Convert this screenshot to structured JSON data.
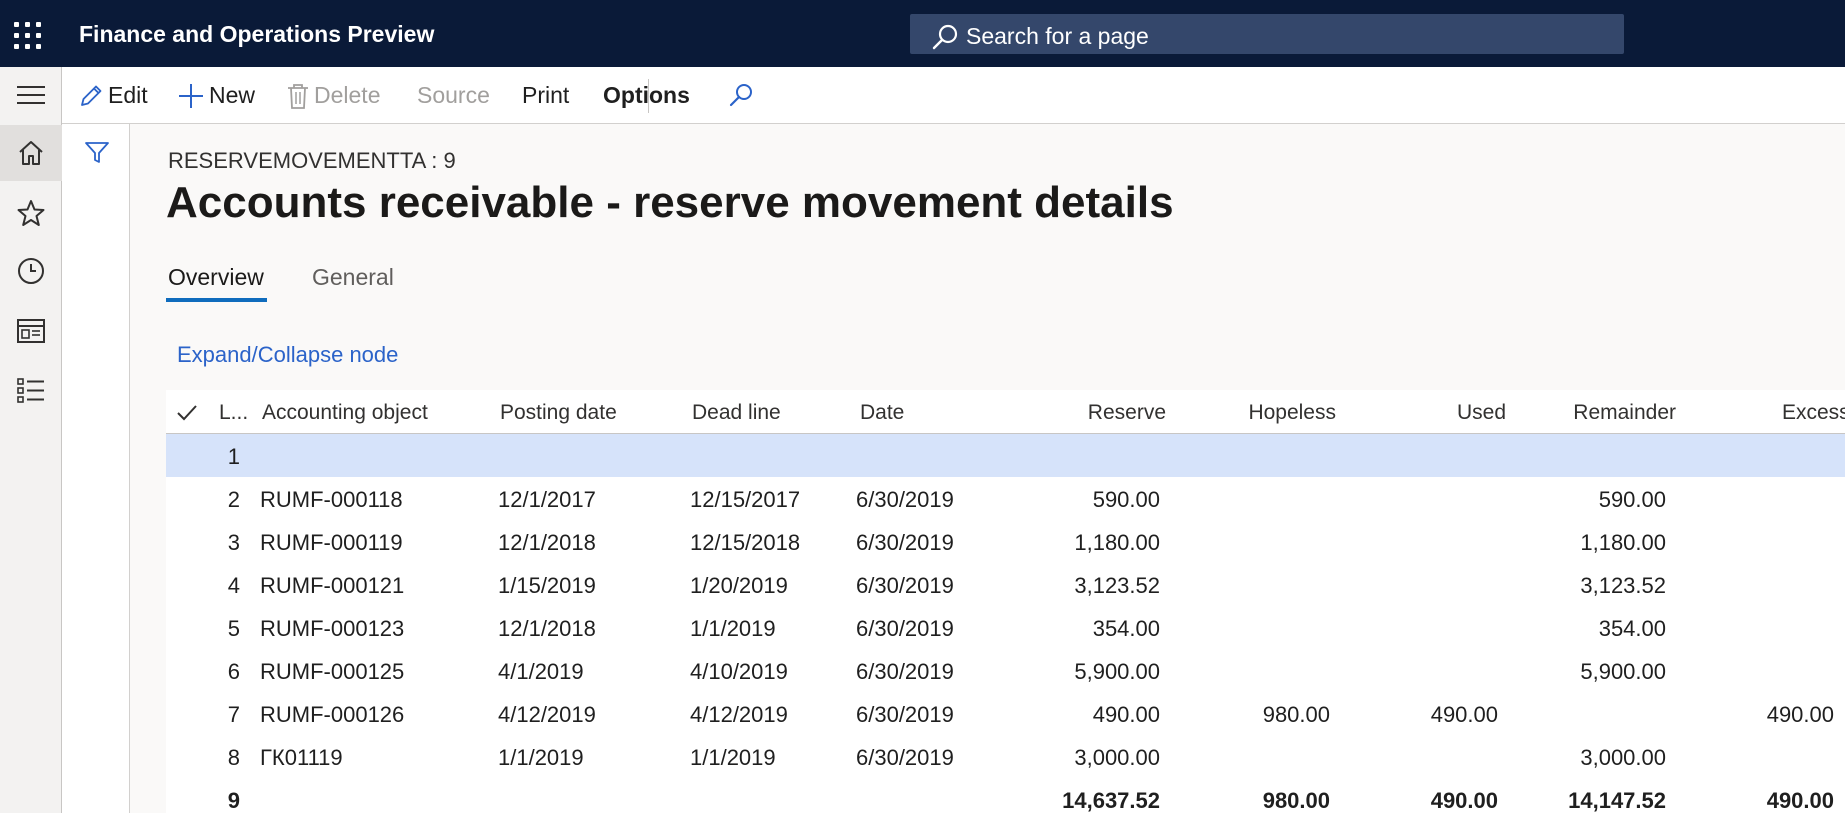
{
  "app": {
    "title": "Finance and Operations Preview",
    "search_placeholder": "Search for a page"
  },
  "nav_rail": {
    "items": [
      "menu-icon",
      "home-icon",
      "star-icon",
      "clock-icon",
      "workspace-icon",
      "list-icon"
    ]
  },
  "action_pane": {
    "edit_label": "Edit",
    "new_label": "New",
    "delete_label": "Delete",
    "source_label": "Source",
    "print_label": "Print",
    "options_label": "Options"
  },
  "page": {
    "caption": "RESERVEMOVEMENTTA : 9",
    "title": "Accounts receivable - reserve movement details",
    "tabs": [
      {
        "label": "Overview",
        "active": true
      },
      {
        "label": "General",
        "active": false
      }
    ],
    "expand_link": "Expand/Collapse node"
  },
  "grid": {
    "columns": [
      "L...",
      "Accounting object",
      "Posting date",
      "Dead line",
      "Date",
      "Reserve",
      "Hopeless",
      "Used",
      "Remainder",
      "Excess"
    ],
    "rows": [
      {
        "line": "1",
        "object": "",
        "posting": "",
        "deadline": "",
        "date": "",
        "reserve": "",
        "hopeless": "",
        "used": "",
        "remainder": "",
        "excess": "",
        "selected": true
      },
      {
        "line": "2",
        "object": "RUMF-000118",
        "posting": "12/1/2017",
        "deadline": "12/15/2017",
        "date": "6/30/2019",
        "reserve": "590.00",
        "hopeless": "",
        "used": "",
        "remainder": "590.00",
        "excess": ""
      },
      {
        "line": "3",
        "object": "RUMF-000119",
        "posting": "12/1/2018",
        "deadline": "12/15/2018",
        "date": "6/30/2019",
        "reserve": "1,180.00",
        "hopeless": "",
        "used": "",
        "remainder": "1,180.00",
        "excess": ""
      },
      {
        "line": "4",
        "object": "RUMF-000121",
        "posting": "1/15/2019",
        "deadline": "1/20/2019",
        "date": "6/30/2019",
        "reserve": "3,123.52",
        "hopeless": "",
        "used": "",
        "remainder": "3,123.52",
        "excess": ""
      },
      {
        "line": "5",
        "object": "RUMF-000123",
        "posting": "12/1/2018",
        "deadline": "1/1/2019",
        "date": "6/30/2019",
        "reserve": "354.00",
        "hopeless": "",
        "used": "",
        "remainder": "354.00",
        "excess": ""
      },
      {
        "line": "6",
        "object": "RUMF-000125",
        "posting": "4/1/2019",
        "deadline": "4/10/2019",
        "date": "6/30/2019",
        "reserve": "5,900.00",
        "hopeless": "",
        "used": "",
        "remainder": "5,900.00",
        "excess": ""
      },
      {
        "line": "7",
        "object": "RUMF-000126",
        "posting": "4/12/2019",
        "deadline": "4/12/2019",
        "date": "6/30/2019",
        "reserve": "490.00",
        "hopeless": "980.00",
        "used": "490.00",
        "remainder": "",
        "excess": "490.00"
      },
      {
        "line": "8",
        "object": "ГК01119",
        "posting": "1/1/2019",
        "deadline": "1/1/2019",
        "date": "6/30/2019",
        "reserve": "3,000.00",
        "hopeless": "",
        "used": "",
        "remainder": "3,000.00",
        "excess": ""
      },
      {
        "line": "9",
        "object": "",
        "posting": "",
        "deadline": "",
        "date": "",
        "reserve": "14,637.52",
        "hopeless": "980.00",
        "used": "490.00",
        "remainder": "14,147.52",
        "excess": "490.00",
        "total": true
      }
    ]
  }
}
